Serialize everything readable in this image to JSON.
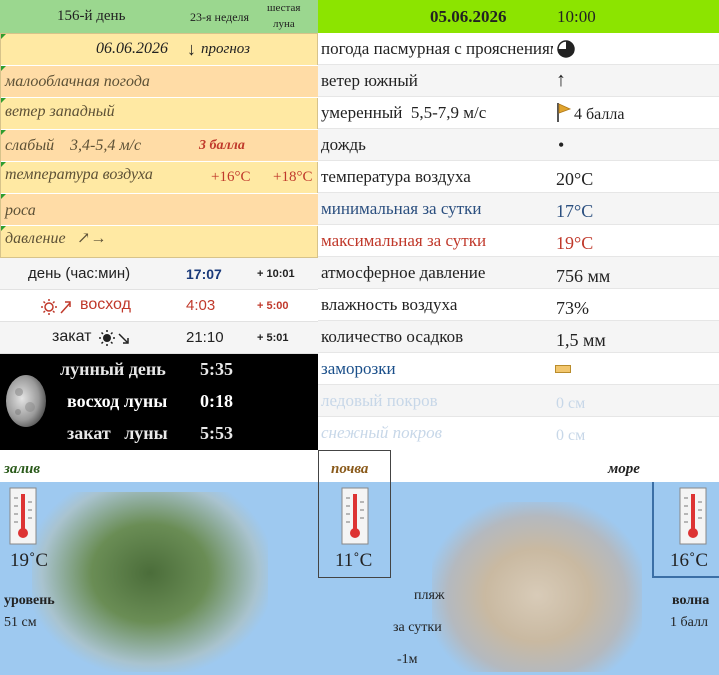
{
  "top_bar": {
    "day_of_year": "156-й день",
    "week": "23-я неделя",
    "moon_phase_line1": "шестая",
    "moon_phase_line2": "луна",
    "date": "05.06.2026",
    "time": "10:00"
  },
  "forecast": {
    "date": "06.06.2026",
    "arrow": "↓",
    "label": "прогноз",
    "cloud": "малооблачная погода",
    "wind_dir": "ветер западный",
    "wind_strength": "слабый",
    "wind_speed": "3,4-5,4 м/с",
    "wind_score": "3 балла",
    "temp_label": "температура воздуха",
    "temp_min": "+16°C",
    "temp_max": "+18°C",
    "dew": "роса",
    "pressure": "давление",
    "pressure_arrow": "↗→"
  },
  "sun": {
    "daylength_label": "день (час:мин)",
    "daylength": "17:07",
    "daylength_delta": "+ 10:01",
    "sunrise_label": "восход",
    "sunrise": "4:03",
    "sunrise_delta": "+ 5:00",
    "sunset_label": "закат",
    "sunset": "21:10",
    "sunset_delta": "+ 5:01"
  },
  "moon": {
    "day_label": "лунный день",
    "day": "5:35",
    "rise_label": "восход луны",
    "rise": "0:18",
    "set_label": "закат   луны",
    "set": "5:53"
  },
  "current": {
    "weather": "погода пасмурная с прояснениями",
    "wind_dir_label": "ветер южный",
    "wind_dir_arrow": "↑",
    "wind_speed_label": "умеренный  5,5-7,9 м/с",
    "wind_score": "4 балла",
    "precip_type": "дождь",
    "precip_icon": "•",
    "air_temp_label": "температура воздуха",
    "air_temp": "20°C",
    "min_label": "минимальная за сутки",
    "min_temp": "17°C",
    "max_label": "максимальная за сутки",
    "max_temp": "19°C",
    "pressure_label": "атмосферное давление",
    "pressure": "756 мм",
    "humidity_label": "влажность воздуха",
    "humidity": "73%",
    "rain_label": "количество осадков",
    "rain": "1,5 мм",
    "frost_label": "заморозки",
    "ice_label": "ледовый покров",
    "ice": "0 см",
    "snow_label": "снежный покров",
    "snow": "0 см"
  },
  "bottom": {
    "bay_label": "залив",
    "bay_temp": "19˚C",
    "bay_level_label": "уровень",
    "bay_level": "51 см",
    "soil_label": "почва",
    "soil_temp": "11˚C",
    "beach_label": "пляж",
    "beach_period": "за сутки",
    "beach_change": "-1м",
    "sea_label": "море",
    "sea_temp": "16˚C",
    "wave_label": "волна",
    "wave_score": "1 балл"
  },
  "colors": {
    "topbar_left": "#9bd78f",
    "topbar_right": "#8ce400",
    "forecast_bg": "#ffe9a3",
    "forecast_alt": "#ffdca6",
    "min_temp": "#2b4f7f",
    "max_temp": "#c0392b",
    "frost_dim": "#1a4f8a",
    "sky": "#9ec9f0"
  }
}
